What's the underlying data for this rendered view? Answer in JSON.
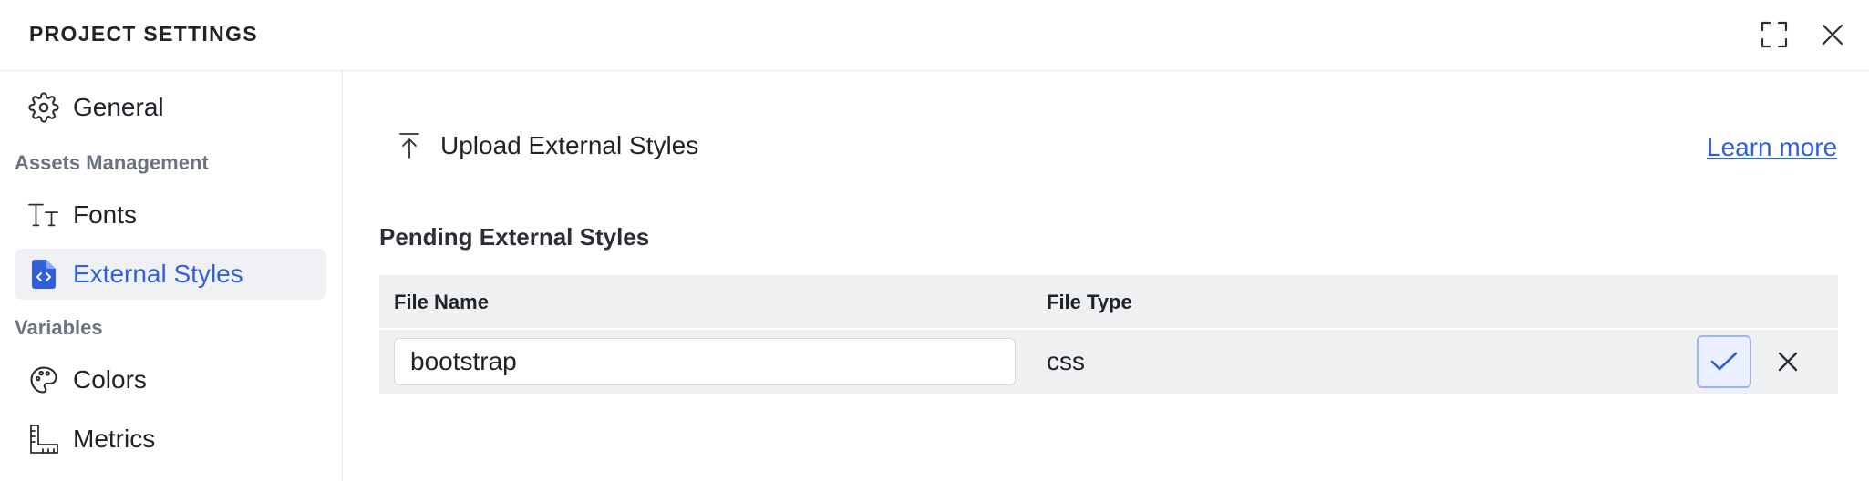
{
  "header": {
    "title": "PROJECT SETTINGS",
    "expand_icon": "expand-icon",
    "close_icon": "close-icon"
  },
  "sidebar": {
    "items": [
      {
        "label": "General",
        "icon": "gear-icon",
        "active": false
      },
      {
        "section": "Assets Management"
      },
      {
        "label": "Fonts",
        "icon": "font-icon",
        "active": false
      },
      {
        "label": "External Styles",
        "icon": "code-file-icon",
        "active": true
      },
      {
        "section": "Variables"
      },
      {
        "label": "Colors",
        "icon": "palette-icon",
        "active": false
      },
      {
        "label": "Metrics",
        "icon": "ruler-icon",
        "active": false
      }
    ]
  },
  "main": {
    "upload_label": "Upload External Styles",
    "learn_more": "Learn more",
    "pending_title": "Pending External Styles",
    "table": {
      "columns": [
        "File Name",
        "File Type"
      ],
      "rows": [
        {
          "file_name": "bootstrap",
          "file_type": "css"
        }
      ]
    }
  },
  "colors": {
    "accent": "#2f5fd9",
    "active_bg": "#eff1f4",
    "table_bg": "#eef0f2"
  }
}
